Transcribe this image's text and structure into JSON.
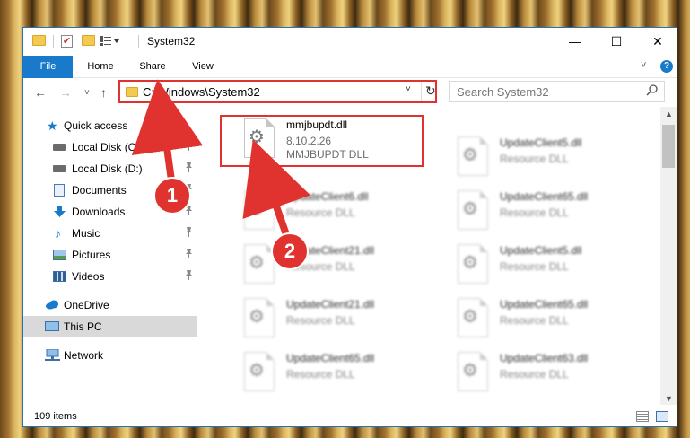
{
  "window": {
    "title": "System32",
    "minimize": "—",
    "maximize": "☐",
    "close": "✕"
  },
  "ribbon": {
    "tabs": [
      "File",
      "Home",
      "Share",
      "View"
    ],
    "expand": "˅",
    "help": "?"
  },
  "nav": {
    "back": "←",
    "forward": "→",
    "recent": "˅",
    "up": "↑",
    "address": "C:\\Windows\\System32",
    "dropdown": "˅",
    "refresh": "↻",
    "search_placeholder": "Search System32",
    "search_icon": "⌕"
  },
  "sidebar": {
    "items": [
      {
        "label": "Quick access",
        "icon": "star-icon",
        "pinned": false
      },
      {
        "label": "Local Disk (C:)",
        "icon": "drive-icon",
        "pinned": true
      },
      {
        "label": "Local Disk (D:)",
        "icon": "drive-icon",
        "pinned": true
      },
      {
        "label": "Documents",
        "icon": "documents-icon",
        "pinned": true
      },
      {
        "label": "Downloads",
        "icon": "download-icon",
        "pinned": true
      },
      {
        "label": "Music",
        "icon": "music-icon",
        "pinned": true
      },
      {
        "label": "Pictures",
        "icon": "pictures-icon",
        "pinned": true
      },
      {
        "label": "Videos",
        "icon": "videos-icon",
        "pinned": true
      },
      {
        "label": "OneDrive",
        "icon": "cloud-icon",
        "pinned": false
      },
      {
        "label": "This PC",
        "icon": "computer-icon",
        "pinned": false,
        "selected": true
      },
      {
        "label": "Network",
        "icon": "network-icon",
        "pinned": false
      }
    ],
    "pin_glyph": "📌"
  },
  "files": [
    {
      "name": "mmjbupdt.dll",
      "version": "8.10.2.26",
      "description": "MMJBUPDT DLL",
      "highlighted": true
    },
    {
      "name": "UpdateClient5.dll",
      "description": "Resource DLL"
    },
    {
      "name": "UpdateClient6.dll",
      "description": "Resource DLL"
    },
    {
      "name": "UpdateClient65.dll",
      "description": "Resource DLL"
    },
    {
      "name": "UpdateClient21.dll",
      "description": "Resource DLL"
    },
    {
      "name": "UpdateClient5.dll",
      "description": "Resource DLL"
    },
    {
      "name": "UpdateClient21.dll",
      "description": "Resource DLL"
    },
    {
      "name": "UpdateClient65.dll",
      "description": "Resource DLL"
    },
    {
      "name": "UpdateClient65.dll",
      "description": "Resource DLL"
    },
    {
      "name": "UpdateClient63.dll",
      "description": "Resource DLL"
    }
  ],
  "status": {
    "item_count": "109 items"
  },
  "annotations": {
    "step1": "1",
    "step2": "2",
    "color": "#e0332f"
  }
}
